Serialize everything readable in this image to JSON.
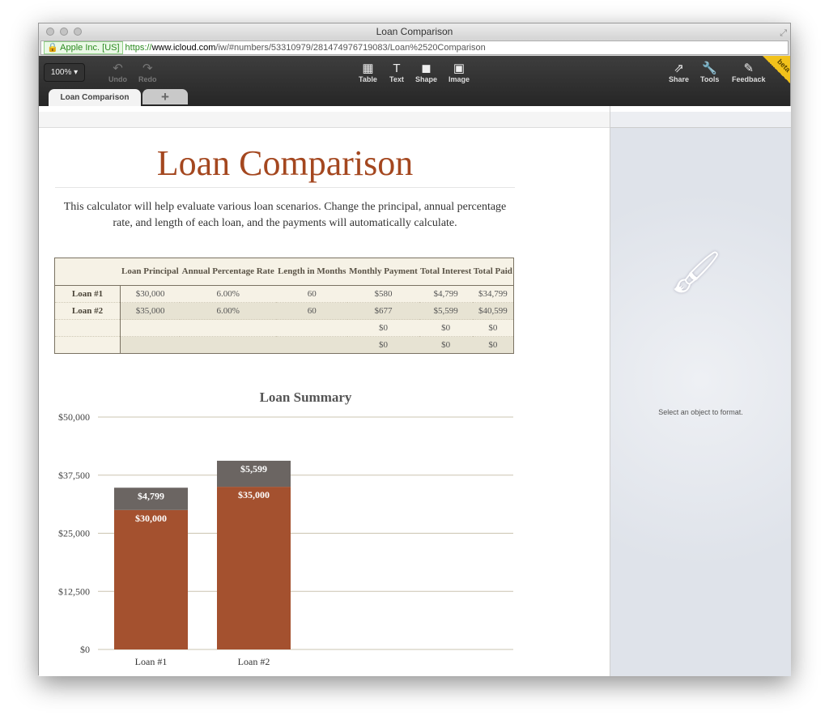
{
  "window": {
    "title": "Loan Comparison"
  },
  "urlbar": {
    "cert": "Apple Inc. [US]",
    "scheme": "https://",
    "domain": "www.icloud.com",
    "path": "/iw/#numbers/53310979/281474976719083/Loan%2520Comparison"
  },
  "toolbar": {
    "zoom": "100% ▾",
    "undo": "Undo",
    "redo": "Redo",
    "table": "Table",
    "text": "Text",
    "shape": "Shape",
    "image": "Image",
    "share": "Share",
    "tools": "Tools",
    "feedback": "Feedback",
    "beta": "beta"
  },
  "tabs": {
    "active": "Loan Comparison",
    "add": "+"
  },
  "doc": {
    "title": "Loan Comparison",
    "intro": "This calculator will help evaluate various loan scenarios. Change the principal, annual percentage rate, and length of each loan, and the payments will automatically calculate."
  },
  "table": {
    "headers": [
      "",
      "Loan Principal",
      "Annual Percentage Rate",
      "Length in Months",
      "Monthly Payment",
      "Total Interest",
      "Total Paid"
    ],
    "rows": [
      [
        "Loan #1",
        "$30,000",
        "6.00%",
        "60",
        "$580",
        "$4,799",
        "$34,799"
      ],
      [
        "Loan #2",
        "$35,000",
        "6.00%",
        "60",
        "$677",
        "$5,599",
        "$40,599"
      ],
      [
        "",
        "",
        "",
        "",
        "$0",
        "$0",
        "$0"
      ],
      [
        "",
        "",
        "",
        "",
        "$0",
        "$0",
        "$0"
      ]
    ]
  },
  "side": {
    "message": "Select an object to format."
  },
  "chart_data": {
    "type": "bar",
    "stacked": true,
    "title": "Loan Summary",
    "categories": [
      "Loan #1",
      "Loan #2"
    ],
    "series": [
      {
        "values": [
          30000,
          35000
        ],
        "labels": [
          "$30,000",
          "$35,000"
        ],
        "color": "#a4512f"
      },
      {
        "values": [
          4799,
          5599
        ],
        "labels": [
          "$4,799",
          "$5,599"
        ],
        "color": "#6b6562"
      }
    ],
    "ylim": [
      0,
      50000
    ],
    "yticks": [
      "$0",
      "$12,500",
      "$25,000",
      "$37,500",
      "$50,000"
    ],
    "grid": true
  }
}
